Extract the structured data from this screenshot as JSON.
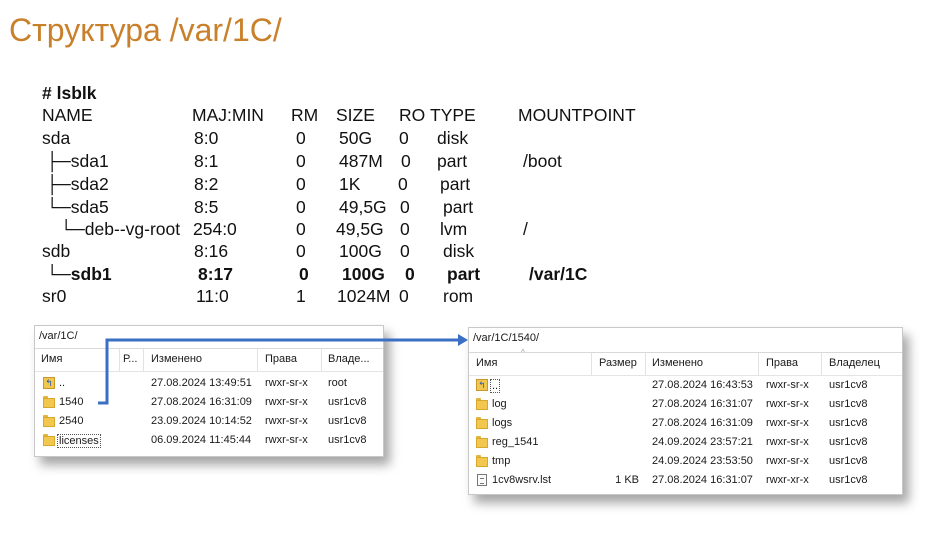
{
  "slide": {
    "title": "Структура /var/1C/"
  },
  "lsblk": {
    "command": "# lsblk",
    "header": [
      "NAME",
      "MAJ:MIN",
      "RM",
      "SIZE",
      "RO",
      "TYPE",
      "MOUNTPOINT"
    ],
    "rows": [
      {
        "name": "sda",
        "majmin": "8:0",
        "rm": "0",
        "size": "50G",
        "ro": "0",
        "type": "disk",
        "mount": ""
      },
      {
        "name": "├─sda1",
        "majmin": "8:1",
        "rm": "0",
        "size": "487M",
        "ro": "0",
        "type": "part",
        "mount": "/boot"
      },
      {
        "name": "├─sda2",
        "majmin": "8:2",
        "rm": "0",
        "size": "1K",
        "ro": "0",
        "type": "part",
        "mount": ""
      },
      {
        "name": "└─sda5",
        "majmin": "8:5",
        "rm": "0",
        "size": "49,5G",
        "ro": "0",
        "type": "part",
        "mount": ""
      },
      {
        "name": "└─deb--vg-root",
        "majmin": "254:0",
        "rm": "0",
        "size": "49,5G",
        "ro": "0",
        "type": "lvm",
        "mount": "/"
      },
      {
        "name": "sdb",
        "majmin": "8:16",
        "rm": "0",
        "size": "100G",
        "ro": "0",
        "type": "disk",
        "mount": ""
      },
      {
        "name": "└─sdb1",
        "majmin": "8:17",
        "rm": "0",
        "size": "100G",
        "ro": "0",
        "type": "part",
        "mount": "/var/1C"
      },
      {
        "name": "sr0",
        "majmin": "11:0",
        "rm": "1",
        "size": "1024M",
        "ro": "0",
        "type": "rom",
        "mount": ""
      }
    ]
  },
  "left_panel": {
    "path": "/var/1C/",
    "columns": {
      "name": "Имя",
      "size": "Р...",
      "modified": "Изменено",
      "rights": "Права",
      "owner": "Владе..."
    },
    "files": [
      {
        "icon": "parent-folder-icon",
        "name": "..",
        "modified": "27.08.2024 13:49:51",
        "rights": "rwxr-sr-x",
        "owner": "root"
      },
      {
        "icon": "folder-icon",
        "name": "1540",
        "modified": "27.08.2024 16:31:09",
        "rights": "rwxr-sr-x",
        "owner": "usr1cv8"
      },
      {
        "icon": "folder-icon",
        "name": "2540",
        "modified": "23.09.2024 10:14:52",
        "rights": "rwxr-sr-x",
        "owner": "usr1cv8"
      },
      {
        "icon": "folder-icon",
        "name": "licenses",
        "modified": "06.09.2024 11:45:44",
        "rights": "rwxr-sr-x",
        "owner": "usr1cv8"
      }
    ]
  },
  "right_panel": {
    "path": "/var/1C/1540/",
    "columns": {
      "name": "Имя",
      "size": "Размер",
      "modified": "Изменено",
      "rights": "Права",
      "owner": "Владелец"
    },
    "files": [
      {
        "icon": "parent-folder-icon",
        "name": "..",
        "size": "",
        "modified": "27.08.2024 16:43:53",
        "rights": "rwxr-sr-x",
        "owner": "usr1cv8"
      },
      {
        "icon": "folder-icon",
        "name": "log",
        "size": "",
        "modified": "27.08.2024 16:31:07",
        "rights": "rwxr-sr-x",
        "owner": "usr1cv8"
      },
      {
        "icon": "folder-icon",
        "name": "logs",
        "size": "",
        "modified": "27.08.2024 16:31:09",
        "rights": "rwxr-sr-x",
        "owner": "usr1cv8"
      },
      {
        "icon": "folder-icon",
        "name": "reg_1541",
        "size": "",
        "modified": "24.09.2024 23:57:21",
        "rights": "rwxr-sr-x",
        "owner": "usr1cv8"
      },
      {
        "icon": "folder-icon",
        "name": "tmp",
        "size": "",
        "modified": "24.09.2024 23:53:50",
        "rights": "rwxr-sr-x",
        "owner": "usr1cv8"
      },
      {
        "icon": "file-icon",
        "name": "1cv8wsrv.lst",
        "size": "1 KB",
        "modified": "27.08.2024 16:31:07",
        "rights": "rwxr-xr-x",
        "owner": "usr1cv8"
      }
    ]
  },
  "colors": {
    "title": "#c9802a",
    "arrow": "#3a6fc4",
    "folder": "#f2c750"
  }
}
